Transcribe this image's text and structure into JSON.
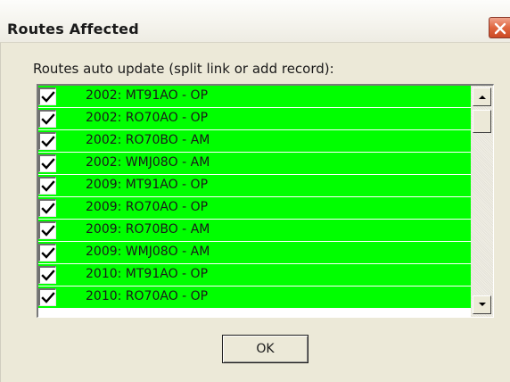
{
  "window": {
    "title": "Routes Affected"
  },
  "group": {
    "label": "Routes auto update (split link or add record):"
  },
  "routes": [
    {
      "label": "2002: MT91AO - OP",
      "checked": true
    },
    {
      "label": "2002: RO70AO - OP",
      "checked": true
    },
    {
      "label": "2002: RO70BO - AM",
      "checked": true
    },
    {
      "label": "2002: WMJ08O - AM",
      "checked": true
    },
    {
      "label": "2009: MT91AO - OP",
      "checked": true
    },
    {
      "label": "2009: RO70AO - OP",
      "checked": true
    },
    {
      "label": "2009: RO70BO - AM",
      "checked": true
    },
    {
      "label": "2009: WMJ08O - AM",
      "checked": true
    },
    {
      "label": "2010: MT91AO - OP",
      "checked": true
    },
    {
      "label": "2010: RO70AO - OP",
      "checked": true
    }
  ],
  "buttons": {
    "ok_label": "OK"
  },
  "colors": {
    "row_highlight": "#00ff00",
    "dialog_face": "#ece9d8",
    "close_button": "#e0663f"
  },
  "icons": {
    "close": "close-x-icon",
    "check": "checkmark-icon",
    "scroll_up": "arrow-up-icon",
    "scroll_down": "arrow-down-icon"
  }
}
